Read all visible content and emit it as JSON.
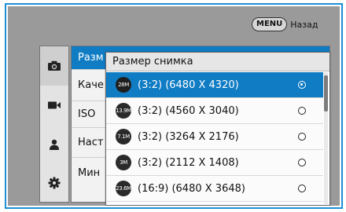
{
  "header": {
    "back_key": "MENU",
    "back_label": "Назад"
  },
  "tabs": [
    {
      "icon": "camera-icon",
      "active": true
    },
    {
      "icon": "video-camera-icon",
      "active": false
    },
    {
      "icon": "person-icon",
      "active": false
    },
    {
      "icon": "settings-gear-icon",
      "active": false
    }
  ],
  "menu": {
    "items": [
      {
        "label": "Разм",
        "active": true
      },
      {
        "label": "Каче",
        "active": false
      },
      {
        "label": "ISO",
        "active": false
      },
      {
        "label": "Наст",
        "active": false
      },
      {
        "label": "Мин",
        "active": false
      }
    ]
  },
  "popup": {
    "title": "Размер снимка",
    "options": [
      {
        "badge": "28M",
        "label": "(3:2) (6480 X 4320)",
        "selected": true
      },
      {
        "badge": "13.9M",
        "label": "(3:2) (4560 X 3040)",
        "selected": false
      },
      {
        "badge": "7.1M",
        "label": "(3:2) (3264 X 2176)",
        "selected": false
      },
      {
        "badge": "3M",
        "label": "(3:2) (2112 X 1408)",
        "selected": false
      },
      {
        "badge": "23.6M",
        "label": "(16:9) (6480 X 3648)",
        "selected": false
      }
    ]
  },
  "colors": {
    "accent": "#0f7cc4",
    "frame": "#1c8fd6",
    "background": "#9a9a9a"
  }
}
